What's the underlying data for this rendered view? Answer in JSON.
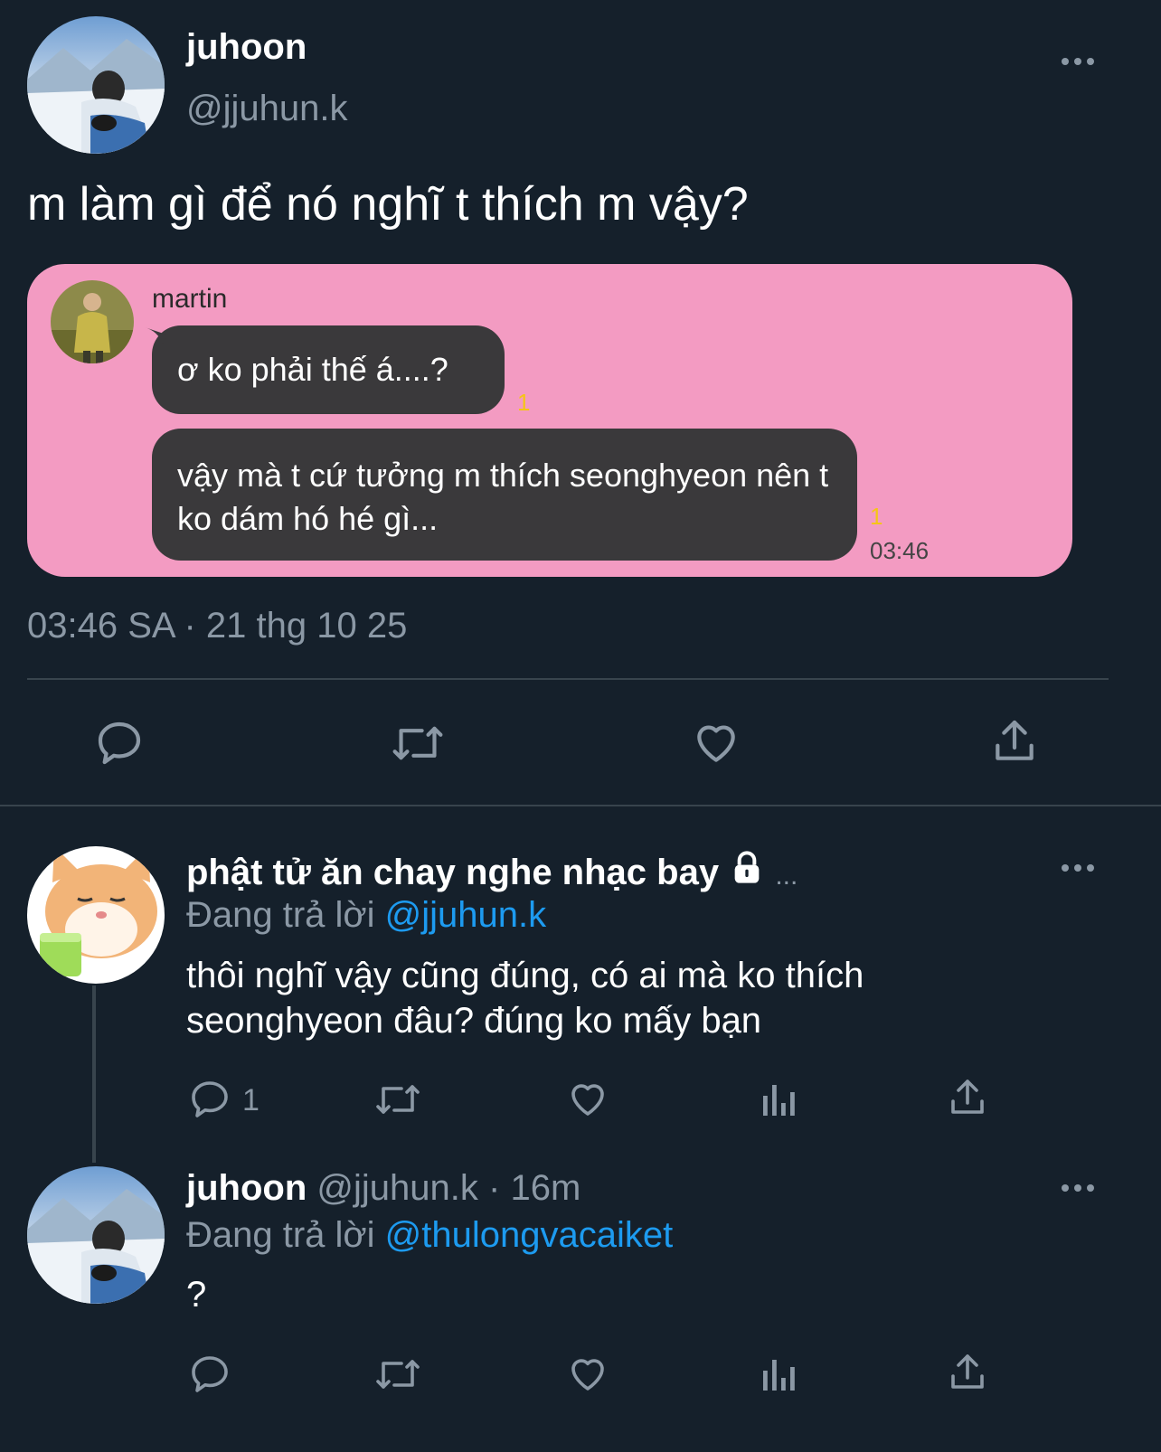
{
  "main_tweet": {
    "display_name": "juhoon",
    "handle": "@jjuhun.k",
    "text": "m làm gì để nó nghĩ t thích m vậy?",
    "timestamp": "03:46 SA · 21 thg 10 25",
    "avatar_icon": "snow-mountain-avatar",
    "more_icon": "more-dots-icon",
    "chat_screenshot": {
      "background": "#f39bc2",
      "sender_name": "martin",
      "messages": [
        {
          "text": "ơ ko phải thế á....?",
          "unread": "1",
          "time": ""
        },
        {
          "text": "vậy mà t cứ tưởng m thích seonghyeon nên t ko dám hó hé gì...",
          "unread": "1",
          "time": "03:46"
        }
      ]
    },
    "actions": [
      "reply-icon",
      "retweet-icon",
      "like-icon",
      "share-icon"
    ]
  },
  "replies": [
    {
      "display_name": "phật tử ăn chay nghe nhạc bay",
      "locked": true,
      "ellipsis": "...",
      "replying_to_prefix": "Đang trả lời",
      "replying_to_handle": "@jjuhun.k",
      "text": "thôi nghĩ vậy cũng đúng, có ai mà ko thích seonghyeon đâu? đúng ko mấy bạn",
      "reply_count": "1",
      "avatar_icon": "cat-drinking-avatar"
    },
    {
      "display_name": "juhoon",
      "handle": "@jjuhun.k",
      "time": "· 16m",
      "replying_to_prefix": "Đang trả lời",
      "replying_to_handle": "@thulongvacaiket",
      "text": "?",
      "reply_count": "",
      "avatar_icon": "snow-mountain-avatar"
    }
  ],
  "colors": {
    "background": "#15202b",
    "muted": "#8b98a5",
    "link": "#1d9bf0",
    "unread": "#f5c518"
  }
}
